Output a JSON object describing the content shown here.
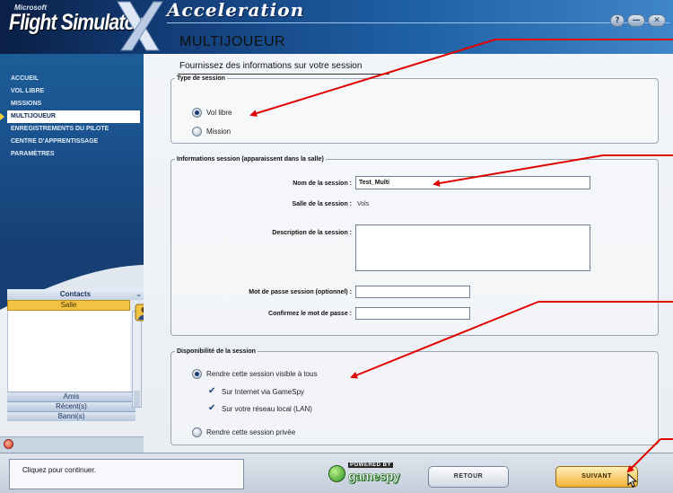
{
  "app": {
    "brand_small": "Microsoft",
    "product": "Flight Simulator",
    "edition": "Acceleration"
  },
  "window_controls": [
    "?",
    "—",
    "✕"
  ],
  "sidebar": {
    "items": [
      {
        "label": "ACCUEIL",
        "active": false
      },
      {
        "label": "VOL LIBRE",
        "active": false
      },
      {
        "label": "MISSIONS",
        "active": false
      },
      {
        "label": "MULTIJOUEUR",
        "active": true
      },
      {
        "label": "ENREGISTREMENTS DU PILOTE",
        "active": false
      },
      {
        "label": "CENTRE D'APPRENTISSAGE",
        "active": false
      },
      {
        "label": "PARAMÈTRES",
        "active": false
      }
    ]
  },
  "contacts": {
    "title": "Contacts",
    "salle": "Salle",
    "tabs": [
      "Amis",
      "Récent(s)",
      "Banni(s)"
    ]
  },
  "main": {
    "title": "MULTIJOUEUR",
    "subtitle": "Fournissez des informations sur votre session",
    "session_type": {
      "legend": "Type de session",
      "options": [
        {
          "label": "Vol libre",
          "selected": true
        },
        {
          "label": "Mission",
          "selected": false
        }
      ]
    },
    "session_info": {
      "legend": "Informations session (apparaissent dans la salle)",
      "name_label": "Nom de la session :",
      "name_value": "Test_Multi",
      "room_label": "Salle de la session :",
      "room_value": "Vols",
      "desc_label": "Description de la session :",
      "desc_value": "",
      "password_label": "Mot de passe session (optionnel) :",
      "password_value": "",
      "confirm_label": "Confirmez le mot de passe :",
      "confirm_value": ""
    },
    "availability": {
      "legend": "Disponibilité de la session",
      "visible_label": "Rendre cette session visible à tous",
      "visible_selected": true,
      "internet_label": "Sur Internet via GameSpy",
      "internet_checked": true,
      "lan_label": "Sur votre réseau local (LAN)",
      "lan_checked": true,
      "private_label": "Rendre cette session privée",
      "private_selected": false
    }
  },
  "footer": {
    "status": "Cliquez pour continuer.",
    "gamespy_powered": "POWERED BY",
    "gamespy_name": "gamespy",
    "back_button": "RETOUR",
    "next_button": "SUIVANT"
  },
  "colors": {
    "sidebar_bg": "#1a5390",
    "header_bg": "#123a73",
    "accent_yellow": "#f0b13a",
    "annotation_red": "#e00000"
  }
}
